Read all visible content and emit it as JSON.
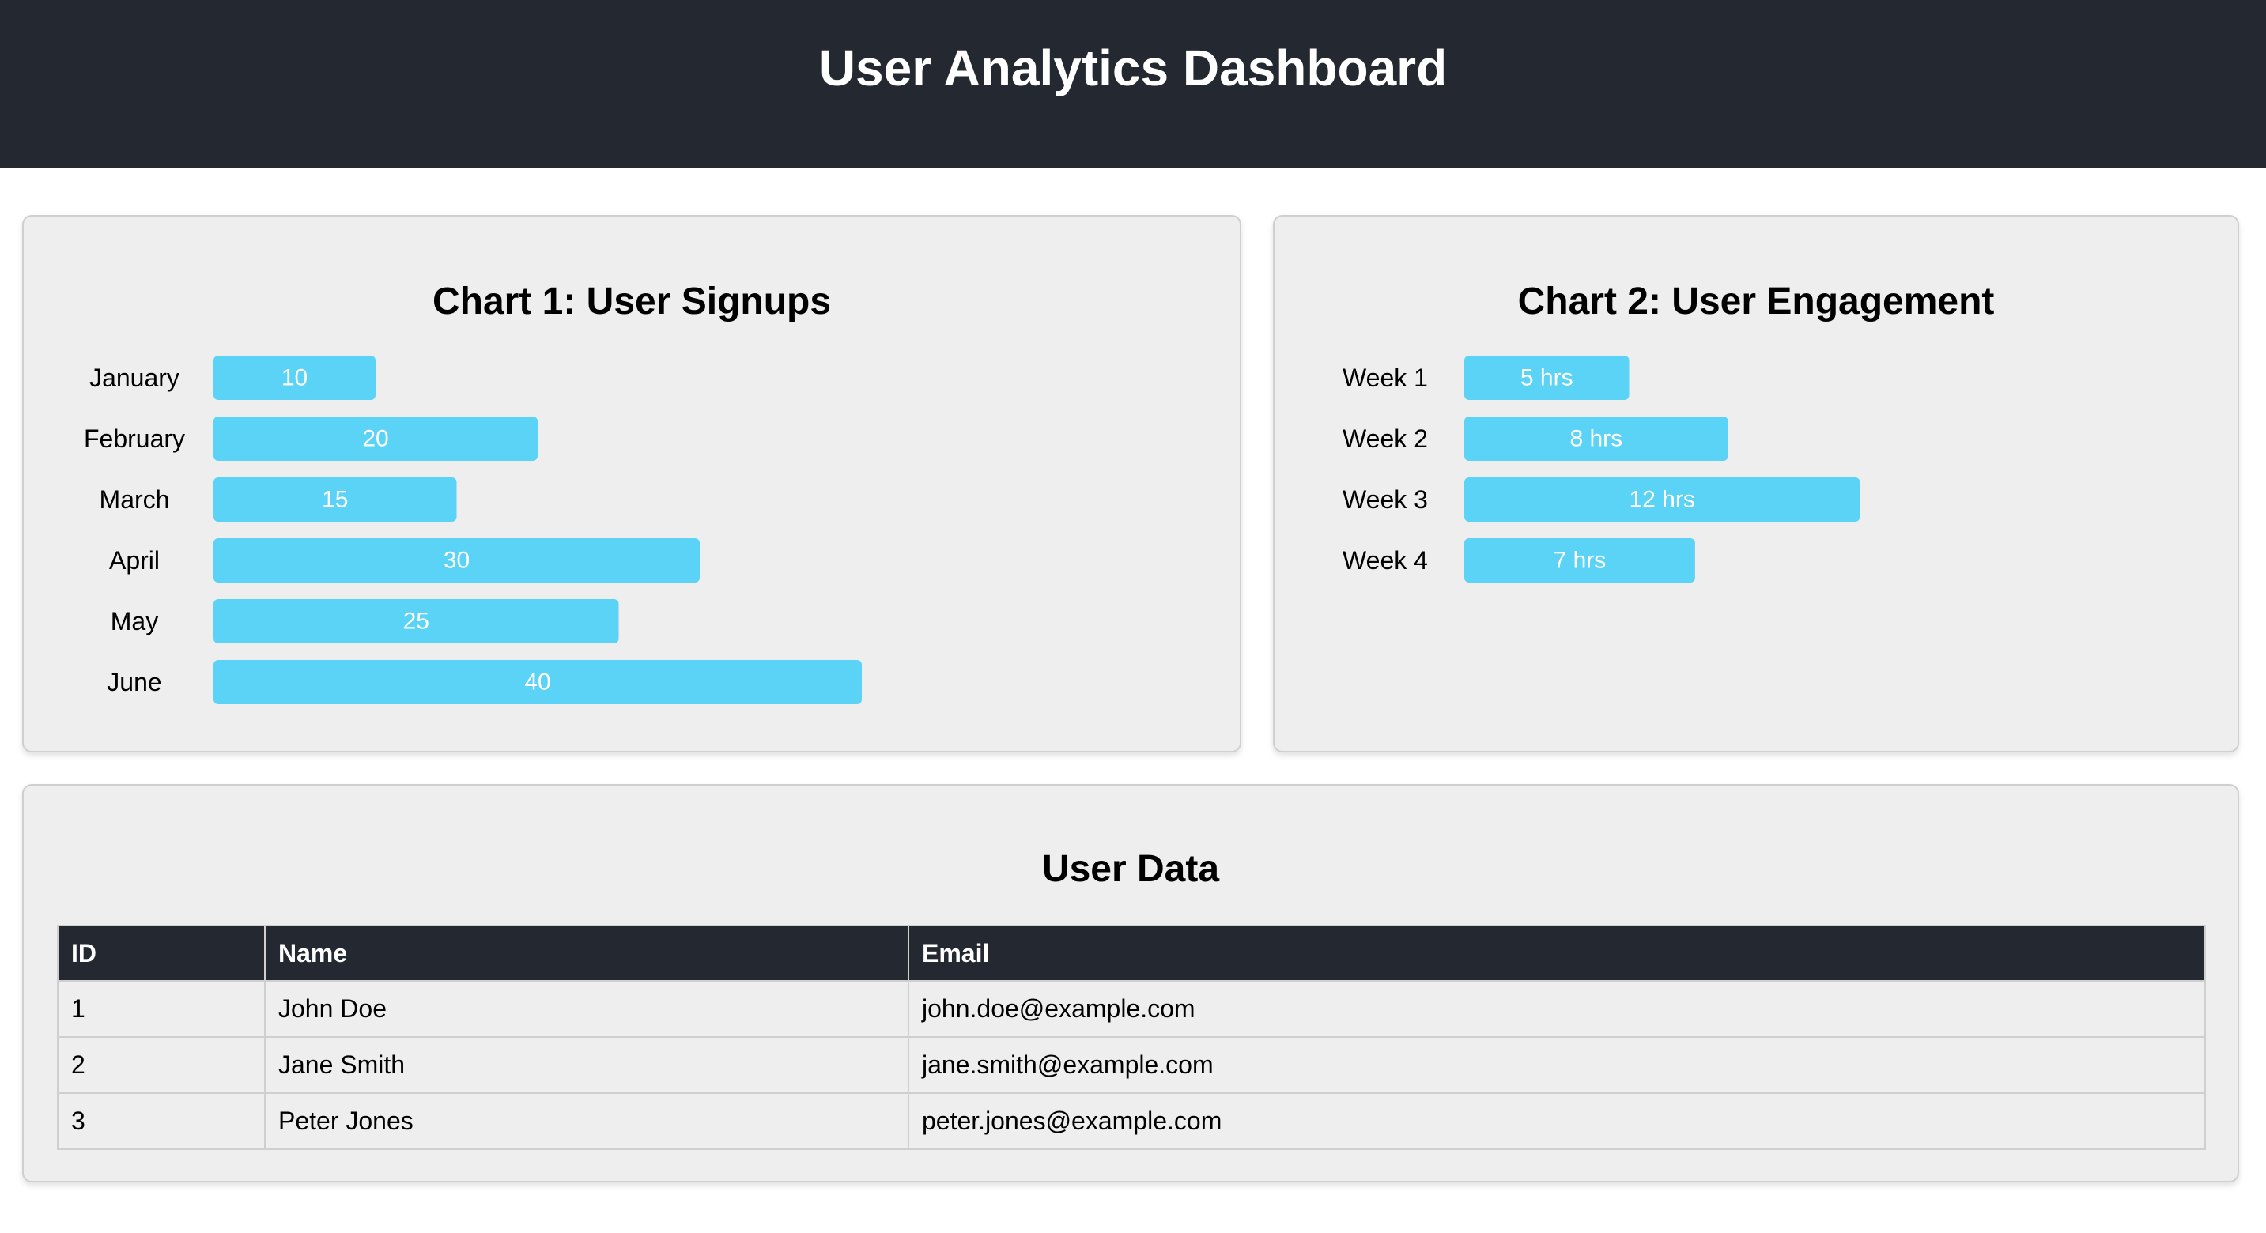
{
  "header": {
    "title": "User Analytics Dashboard"
  },
  "colors": {
    "header_bg": "#242830",
    "bar": "#5ad3f7",
    "panel_bg": "#eeeeee"
  },
  "chart_data": [
    {
      "type": "bar",
      "orientation": "horizontal",
      "title": "Chart 1: User Signups",
      "categories": [
        "January",
        "February",
        "March",
        "April",
        "May",
        "June"
      ],
      "values": [
        10,
        20,
        15,
        30,
        25,
        40
      ],
      "value_labels": [
        "10",
        "20",
        "15",
        "30",
        "25",
        "40"
      ],
      "xlabel": "",
      "ylabel": "",
      "grid": false
    },
    {
      "type": "bar",
      "orientation": "horizontal",
      "title": "Chart 2: User Engagement",
      "categories": [
        "Week 1",
        "Week 2",
        "Week 3",
        "Week 4"
      ],
      "values": [
        5,
        8,
        12,
        7
      ],
      "value_labels": [
        "5 hrs",
        "8 hrs",
        "12 hrs",
        "7 hrs"
      ],
      "unit": "hrs",
      "xlabel": "",
      "ylabel": "",
      "grid": false
    }
  ],
  "user_table": {
    "title": "User Data",
    "columns": [
      "ID",
      "Name",
      "Email"
    ],
    "rows": [
      [
        "1",
        "John Doe",
        "john.doe@example.com"
      ],
      [
        "2",
        "Jane Smith",
        "jane.smith@example.com"
      ],
      [
        "3",
        "Peter Jones",
        "peter.jones@example.com"
      ]
    ]
  }
}
